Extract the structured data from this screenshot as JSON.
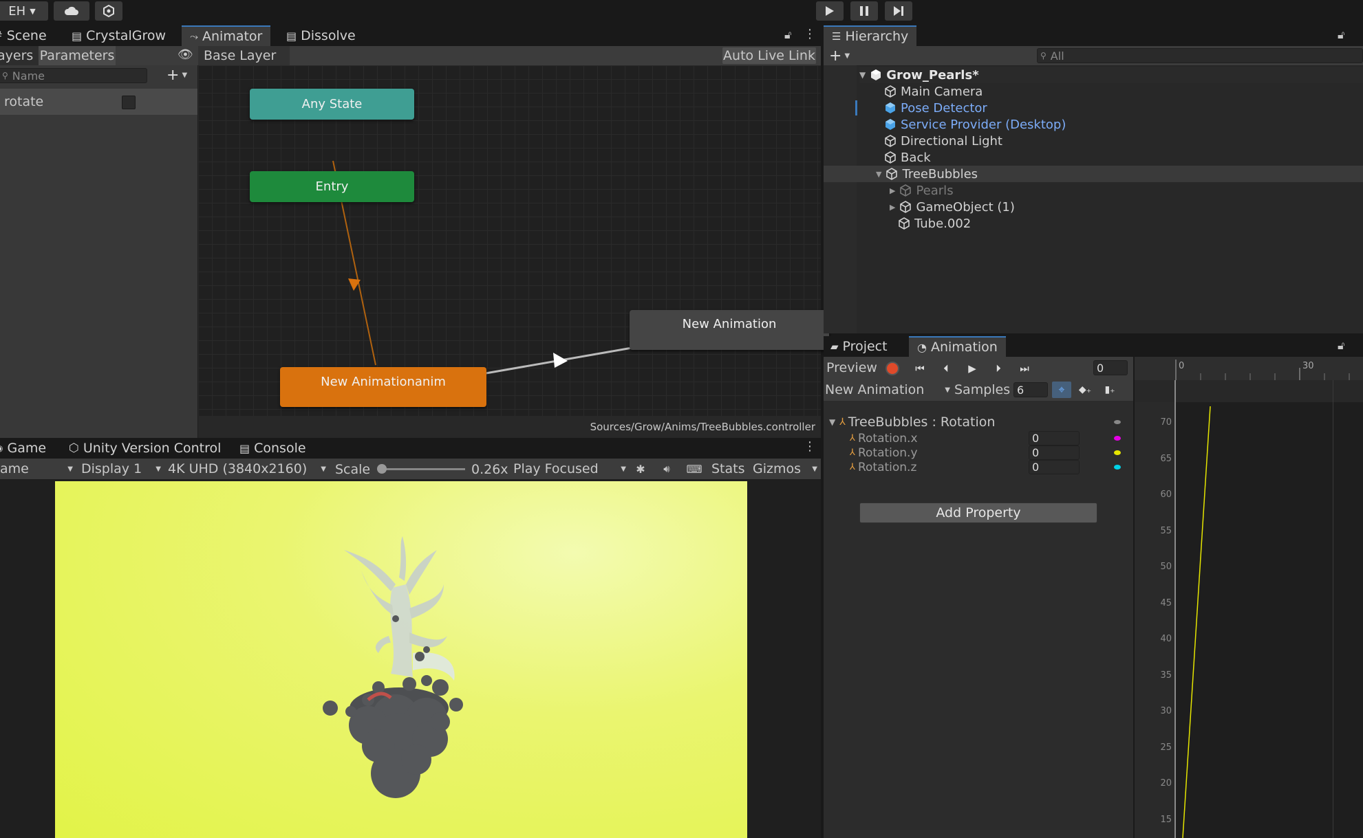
{
  "topbar": {
    "account": "EH",
    "play_icon": "play-icon",
    "pause_icon": "pause-icon",
    "step_icon": "step-icon"
  },
  "animator_window": {
    "tabs": [
      "Scene",
      "CrystalGrow",
      "Animator",
      "Dissolve"
    ],
    "active_tab": "Animator",
    "sub_tabs": [
      "ayers",
      "Parameters"
    ],
    "search_placeholder": "Name",
    "parameter": {
      "name": "rotate",
      "checked": false
    },
    "breadcrumb": "Base Layer",
    "auto_live_link": "Auto Live Link",
    "nodes": {
      "any_state": "Any State",
      "entry": "Entry",
      "default_state": "New Animationanim",
      "state2": "New Animation"
    },
    "controller_path": "Sources/Grow/Anims/TreeBubbles.controller"
  },
  "hierarchy": {
    "tab": "Hierarchy",
    "search_placeholder": "All",
    "scene": "Grow_Pearls*",
    "items": [
      {
        "label": "Main Camera",
        "color": "#d2d2d2"
      },
      {
        "label": "Pose Detector",
        "color": "#7cacf8"
      },
      {
        "label": "Service Provider (Desktop)",
        "color": "#7cacf8"
      },
      {
        "label": "Directional Light",
        "color": "#d2d2d2"
      },
      {
        "label": "Back",
        "color": "#d2d2d2"
      },
      {
        "label": "TreeBubbles",
        "color": "#d2d2d2"
      },
      {
        "label": "Pearls",
        "color": "#7a7a7a"
      },
      {
        "label": "GameObject (1)",
        "color": "#d2d2d2"
      },
      {
        "label": "Tube.002",
        "color": "#d2d2d2"
      }
    ]
  },
  "game_window": {
    "tabs": [
      "Game",
      "Unity Version Control",
      "Console"
    ],
    "mode": "ame",
    "display": "Display 1",
    "resolution": "4K UHD (3840x2160)",
    "scale_label": "Scale",
    "scale_value": "0.26x",
    "play_mode": "Play Focused",
    "stats": "Stats",
    "gizmos": "Gizmos"
  },
  "animation_window": {
    "tabs": [
      "Project",
      "Animation"
    ],
    "preview": "Preview",
    "frame": "0",
    "clip": "New Animation",
    "samples_label": "Samples",
    "samples": "6",
    "property_group": "TreeBubbles : Rotation",
    "properties": [
      {
        "label": "Rotation.x",
        "value": "0",
        "color": "#e600e6"
      },
      {
        "label": "Rotation.y",
        "value": "0",
        "color": "#e6e600"
      },
      {
        "label": "Rotation.z",
        "value": "0",
        "color": "#00d2e6"
      }
    ],
    "add_property": "Add Property",
    "timeline_ticks": [
      "0",
      "30"
    ],
    "curve_axis": [
      "70",
      "65",
      "60",
      "55",
      "50",
      "45",
      "40",
      "35",
      "30",
      "25",
      "20",
      "15"
    ]
  },
  "colors": {
    "any_state": "#3f9e93",
    "entry": "#1e8a3c",
    "default_state": "#d9720e",
    "state": "#454545",
    "game_bg": "#e9f55e",
    "accent": "#3a79bb"
  }
}
